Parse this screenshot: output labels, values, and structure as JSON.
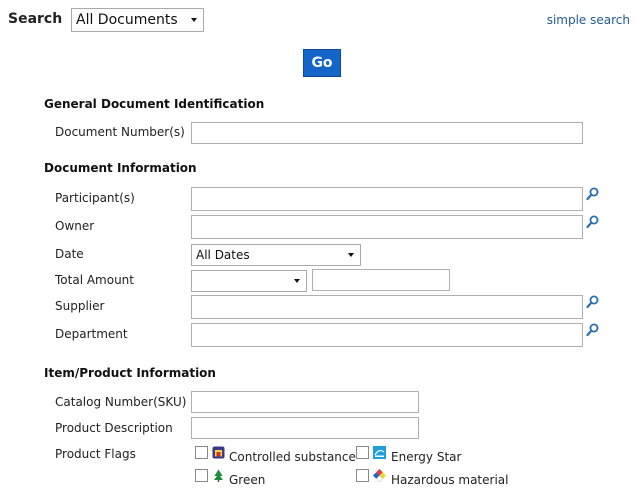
{
  "search": {
    "label": "Search",
    "scope": "All Documents",
    "simple_link": "simple search",
    "go": "Go"
  },
  "sections": {
    "general": "General Document Identification",
    "document": "Document Information",
    "item": "Item/Product Information"
  },
  "fields": {
    "document_number": "Document Number(s)",
    "participants": "Participant(s)",
    "owner": "Owner",
    "date": "Date",
    "date_value": "All Dates",
    "total_amount": "Total Amount",
    "supplier": "Supplier",
    "department": "Department",
    "catalog_number": "Catalog Number(SKU)",
    "product_description": "Product Description",
    "product_flags": "Product Flags"
  },
  "flags": {
    "controlled": "Controlled substance",
    "energy_star": "Energy Star",
    "green": "Green",
    "hazardous": "Hazardous material"
  },
  "colors": {
    "go_button": "#1565c8",
    "link": "#1f5a99"
  }
}
